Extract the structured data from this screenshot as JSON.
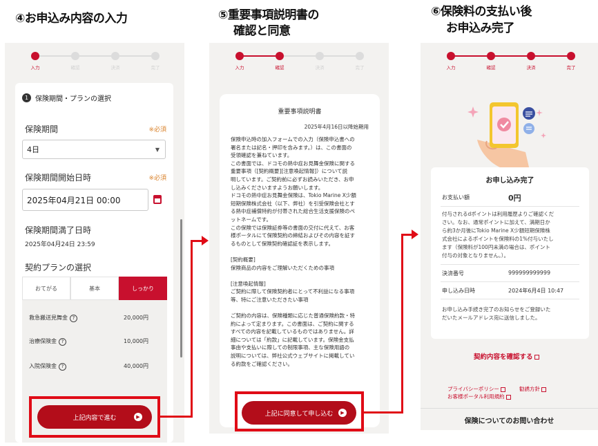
{
  "headings": {
    "step4": "④お申込み内容の入力",
    "step5_line1": "⑤重要事項説明書の",
    "step5_line2": "確認と同意",
    "step6_line1": "⑥保険料の支払い後",
    "step6_line2": "お申込み完了"
  },
  "stepper_labels": [
    "入力",
    "確認",
    "決済",
    "完了"
  ],
  "panel1": {
    "section_number": "1",
    "section_title": "保険期間・プランの選択",
    "required_label": "※必須",
    "period_label": "保険期間",
    "period_value": "4日",
    "start_label": "保険期間開始日時",
    "start_value": "2025年04月21日 00:00",
    "end_label": "保険期間満了日時",
    "end_value": "2025年04月24日 23:59",
    "plan_label": "契約プランの選択",
    "plans": [
      "おてがる",
      "基本",
      "しっかり"
    ],
    "coverage": [
      {
        "name": "救急搬送見舞金",
        "amount": "20,000円"
      },
      {
        "name": "治療保険金",
        "amount": "10,000円"
      },
      {
        "name": "入院保険金",
        "amount": "40,000円"
      }
    ],
    "button_label": "上記内容で進む"
  },
  "panel2": {
    "doc_title": "重要事項説明書",
    "doc_date": "2025年4月16日以降始期用",
    "doc_body": "保険申込時の加入フォームでの入力（保険申込書への\n署名または記名・押印を含みます。）は、この書面の\n受領確認を兼ねています。\nこの書面では、ドコモの熱中症お見舞金保険に関する\n重要事項（[契約概要][注意喚起情報]）について説\n明しています。ご契約前に必ずお読みいただき、お申\nし込みくださいますようお願いします。\nドコモの熱中症お見舞金保険は、Tokio Marine X少額\n短期保険株式会社（以下、弊社）を引受保険会社とす\nる熱中症補償特約が付帯された総合生活支援保険のペ\nットネームです。\nこの保険では保険証券等の書面の交付に代えて、お客\n様ポータルにて保険契約の締結およびその内容を証す\nるものとして保険契約確認証を表示します。\n\n[契約概要]\n保険商品の内容をご理解いただくための事項\n\n[注意喚起情報]\nご契約に際して保険契約者にとって不利益になる事項\n等、特にご注意いただきたい事項\n\nご契約の内容は、保険種類に応じた普通保険約款・特\n約によって定まります。この書面は、ご契約に関する\nすべての内容を記載しているものではありません。詳\n細については「約款」に記載しています。保険金支払\n事由や支払いに際しての制限事項、主な保険用語の\n説明については、弊社公式ウェブサイトに掲載してい\nる約款をご確認ください。",
    "button_label": "上記に同意して申し込む"
  },
  "panel3": {
    "summary_title": "お申し込み完了",
    "paid_label": "お支払い額",
    "paid_value": "0円",
    "points_note": "付与されるdポイントは利用履歴よりご確認くだ\nさい。なお、通常ポイントに加えて、満期日か\nら約3か月後にTokio Marine X少額短期保険株\n式会社によるポイントを保険料の1%付与いたし\nます（保険料が100円未満の場合は、ポイント\n付与の対象となりません。）。",
    "settlement_label": "決済番号",
    "settlement_value": "999999999999",
    "date_label": "申し込み日時",
    "date_value": "2024年6月4日 10:47",
    "email_note": "お申し込み手続き完了のお知らせをご登録いた\nだいたメールアドレス宛に送信しました。",
    "confirm_link": "契約内容を確認する",
    "footer_links": [
      "プライバシーポリシー",
      "勧誘方針",
      "お客様ポータル利用規約"
    ],
    "contact_title": "保険についてのお問い合わせ"
  },
  "colors": {
    "brand_red": "#c8102e",
    "highlight_red": "#e00b16",
    "button_red": "#b30d1a"
  }
}
